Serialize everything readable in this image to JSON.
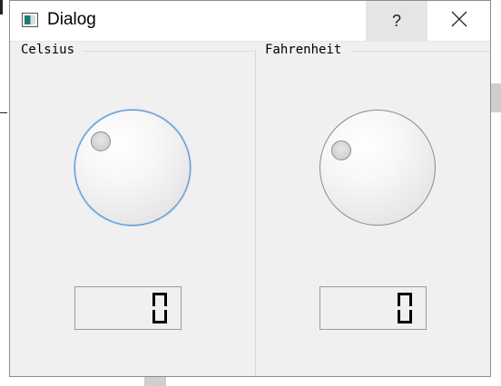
{
  "window": {
    "title": "Dialog",
    "help_label": "?",
    "close_label": "✕"
  },
  "groups": {
    "celsius": {
      "title": "Celsius",
      "value": 0,
      "display": "0"
    },
    "fahrenheit": {
      "title": "Fahrenheit",
      "value": 0,
      "display": "0"
    }
  },
  "colors": {
    "window_bg": "#f0f0f0",
    "focus_ring": "#4f8fcf"
  },
  "icons": {
    "app": "dialog-window-icon",
    "help": "question-mark-icon",
    "close": "close-icon"
  }
}
